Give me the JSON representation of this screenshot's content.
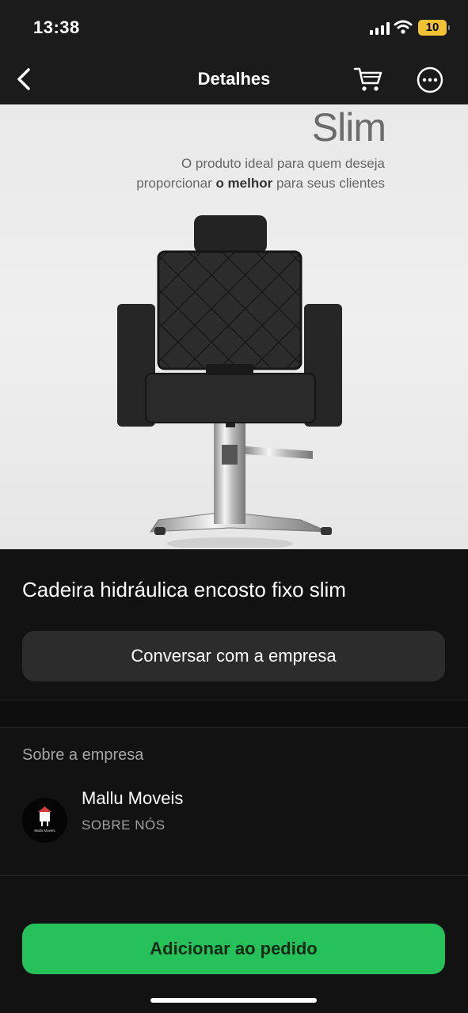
{
  "status": {
    "time": "13:38",
    "battery": "10",
    "battery_color": "#f1c232"
  },
  "nav": {
    "title": "Detalhes"
  },
  "hero": {
    "title": "Slim",
    "tagline_line1": "O produto ideal para quem deseja",
    "tagline_pre": "proporcionar ",
    "tagline_bold": "o melhor",
    "tagline_post": " para seus clientes"
  },
  "product": {
    "title": "Cadeira hidráulica encosto fixo slim"
  },
  "actions": {
    "chat_label": "Conversar com a empresa",
    "add_label": "Adicionar ao pedido",
    "accent": "#26c15a"
  },
  "company": {
    "section_label": "Sobre a empresa",
    "name": "Mallu Moveis",
    "subtitle": "SOBRE NÓS",
    "logo_text": "Mallu Moveis"
  },
  "icons": {
    "back": "chevron-left-icon",
    "cart": "cart-icon",
    "more": "more-options-icon"
  }
}
